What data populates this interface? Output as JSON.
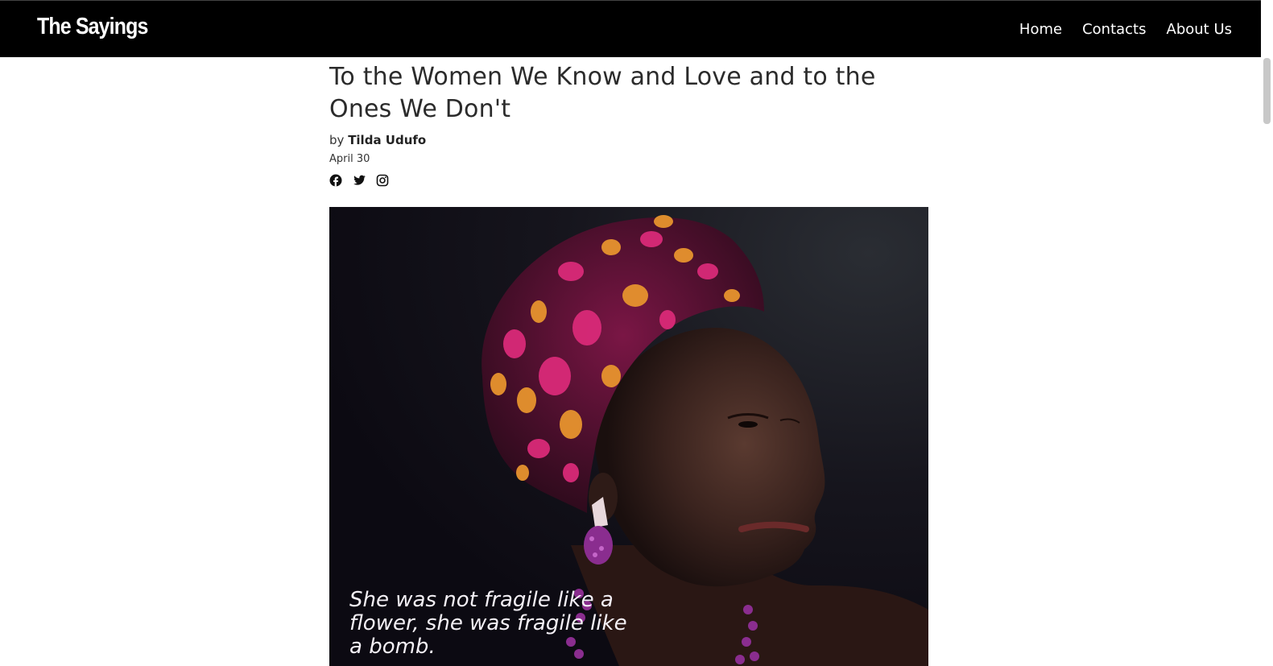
{
  "header": {
    "brand": "The Sayings",
    "nav": [
      {
        "label": "Home"
      },
      {
        "label": "Contacts"
      },
      {
        "label": "About Us"
      }
    ]
  },
  "article": {
    "title": "To the Women We Know and Love and to the Ones We Don't",
    "by_prefix": "by",
    "author": "Tilda Udufo",
    "date": "April 30",
    "share_icons": [
      "facebook-icon",
      "twitter-icon",
      "instagram-icon"
    ],
    "hero_quote": "She was not fragile like a flower, she was fragile like a bomb."
  },
  "colors": {
    "navbar_bg": "#000000",
    "text": "#2b2b2b",
    "headwrap_pink": "#d92a78",
    "headwrap_orange": "#e7932e"
  }
}
